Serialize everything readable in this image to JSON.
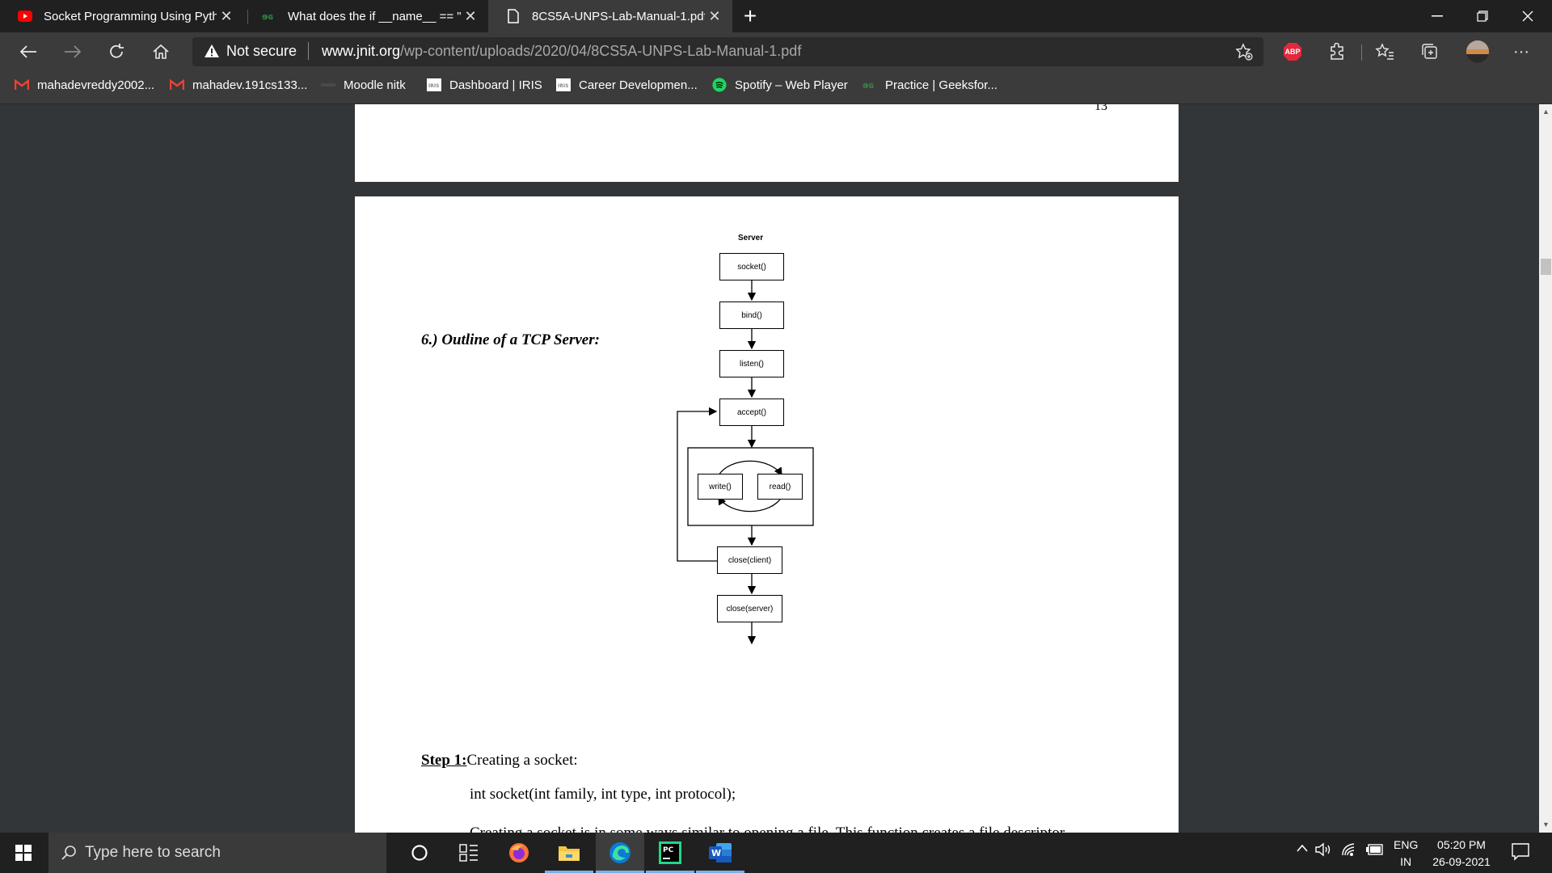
{
  "browser": {
    "tabs": [
      {
        "title": "Socket Programming Using Pyth",
        "icon": "youtube-icon",
        "active": false
      },
      {
        "title": "What does the if __name__ == \"_",
        "icon": "geeksforgeeks-icon",
        "active": false
      },
      {
        "title": "8CS5A-UNPS-Lab-Manual-1.pdf",
        "icon": "document-icon",
        "active": true
      }
    ],
    "new_tab": "+",
    "security_label": "Not secure",
    "url_host": "www.jnit.org",
    "url_path": "/wp-content/uploads/2020/04/8CS5A-UNPS-Lab-Manual-1.pdf",
    "adblock_label": "ABP",
    "more": "···"
  },
  "bookmarks": [
    {
      "label": "mahadevreddy2002...",
      "icon": "gmail-icon"
    },
    {
      "label": "mahadev.191cs133...",
      "icon": "gmail-icon"
    },
    {
      "label": "Moodle nitk",
      "icon": "moodle-icon"
    },
    {
      "label": "Dashboard | IRIS",
      "icon": "iris-icon"
    },
    {
      "label": "Career Developmen...",
      "icon": "iris-icon"
    },
    {
      "label": "Spotify – Web Player",
      "icon": "spotify-icon"
    },
    {
      "label": "Practice | Geeksfor...",
      "icon": "geeksforgeeks-icon"
    }
  ],
  "pdf": {
    "page_number": "13",
    "section_heading": "6.) Outline of a TCP Server:",
    "diagram": {
      "title": "Server",
      "socket": "socket()",
      "bind": "bind()",
      "listen": "listen()",
      "accept": "accept()",
      "write": "write()",
      "read": "read()",
      "close_client": "close(client)",
      "close_server": "close(server)"
    },
    "step1_label": "Step 1:",
    "step1_text": "Creating a socket:",
    "signature": "int socket(int family, int type, int protocol);",
    "partial_line": "Creating a socket is in some ways similar to opening a file. This function creates a file descriptor"
  },
  "taskbar": {
    "search_placeholder": "Type here to search",
    "language": "ENG",
    "region": "IN",
    "time": "05:20 PM",
    "date": "26-09-2021"
  }
}
